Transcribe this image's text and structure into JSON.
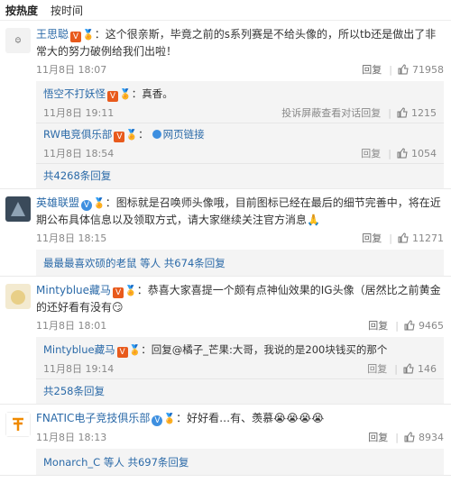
{
  "sort": {
    "hot": "按热度",
    "time": "按时间"
  },
  "comments": [
    {
      "user": "王思聪",
      "text": "：这个很亲斯，毕竟之前的s系列赛是不给头像的，所以tb还是做出了非常大的努力破例给我们出啦！",
      "time": "11月8日 18:07",
      "reply_label": "回复",
      "likes": "71958",
      "replies": [
        {
          "user": "悟空不打妖怪",
          "text": "：真香。",
          "time": "11月8日 19:11",
          "actions": [
            "投诉",
            "屏蔽",
            "查看对话",
            "回复"
          ],
          "likes": "1215"
        },
        {
          "user": "RW电竞俱乐部",
          "text": "网页链接",
          "time": "11月8日 18:54",
          "actions": [
            "回复"
          ],
          "likes": "1054"
        }
      ],
      "more": "共4268条回复"
    },
    {
      "user": "英雄联盟",
      "text": "：图标就是召唤师头像哦，目前图标已经在最后的细节完善中，将在近期公布具体信息以及领取方式，请大家继续关注官方消息",
      "time": "11月8日 18:15",
      "reply_label": "回复",
      "likes": "11271",
      "replies": [],
      "more": "最最最喜欢硕的老鼠 等人 共674条回复"
    },
    {
      "user": "Mintyblue藏马",
      "text": "：恭喜大家喜提一个颇有点神仙效果的IG头像（居然比之前黄金的还好看有没有",
      "time": "11月8日 18:01",
      "reply_label": "回复",
      "likes": "9465",
      "replies": [
        {
          "user": "Mintyblue藏马",
          "text": "：回复@橘子_芒果:大哥，我说的是200块钱买的那个",
          "time": "11月8日 19:14",
          "actions": [
            "回复"
          ],
          "likes": "146"
        }
      ],
      "more": "共258条回复"
    },
    {
      "user": "FNATIC电子竞技俱乐部",
      "text": "：好好看…有、羡慕",
      "time": "11月8日 18:13",
      "reply_label": "回复",
      "likes": "8934",
      "replies": [],
      "more": "Monarch_C 等人 共697条回复"
    }
  ],
  "colors": {
    "link": "#2b6aa8",
    "vip_badge": "#e85a1c",
    "verified_badge": "#3d8fe0"
  },
  "icons": {
    "like": "thumb-up-icon",
    "link": "link-icon"
  }
}
